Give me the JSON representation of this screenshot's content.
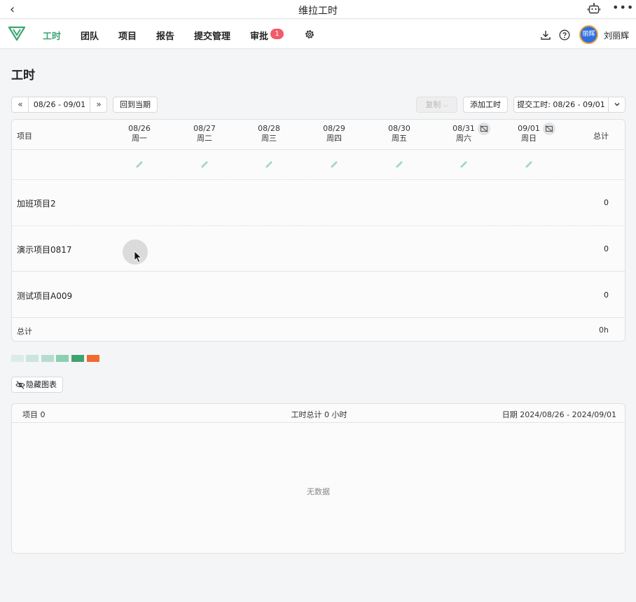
{
  "app": {
    "title": "维拉工时"
  },
  "nav": {
    "items": [
      {
        "label": "工时"
      },
      {
        "label": "团队"
      },
      {
        "label": "项目"
      },
      {
        "label": "报告"
      },
      {
        "label": "提交管理"
      },
      {
        "label": "审批"
      }
    ],
    "approval_badge": "1",
    "accent_color": "#3aa573"
  },
  "user": {
    "avatar_text": "丽辉",
    "name": "刘丽辉"
  },
  "page": {
    "title": "工时"
  },
  "toolbar": {
    "prev": "«",
    "next": "»",
    "date_range": "08/26 - 09/01",
    "today_button": "回到当期",
    "copy_button": "复制",
    "add_button": "添加工时",
    "submit_button": "提交工时: 08/26 - 09/01"
  },
  "grid": {
    "project_header": "项目",
    "total_header": "总计",
    "days": [
      {
        "date": "08/26",
        "weekday": "周一"
      },
      {
        "date": "08/27",
        "weekday": "周二"
      },
      {
        "date": "08/28",
        "weekday": "周三"
      },
      {
        "date": "08/29",
        "weekday": "周四"
      },
      {
        "date": "08/30",
        "weekday": "周五"
      },
      {
        "date": "08/31",
        "weekday": "周六"
      },
      {
        "date": "09/01",
        "weekday": "周日"
      }
    ],
    "rows": [
      {
        "project": "加班项目2",
        "total": "0"
      },
      {
        "project": "演示项目0817",
        "total": "0"
      },
      {
        "project": "测试项目A009",
        "total": "0"
      }
    ],
    "footer_label": "总计",
    "footer_total": "0h"
  },
  "legend_colors": [
    "#dcebe6",
    "#cde4dc",
    "#b6dccd",
    "#8ccfb1",
    "#3fa271",
    "#f26a2e"
  ],
  "chart_toggle": {
    "label": "隐藏图表"
  },
  "summary": {
    "projects": "项目 0",
    "hours": "工时总计 0 小时",
    "date": "日期 2024/08/26 - 2024/09/01",
    "empty": "无数据"
  }
}
